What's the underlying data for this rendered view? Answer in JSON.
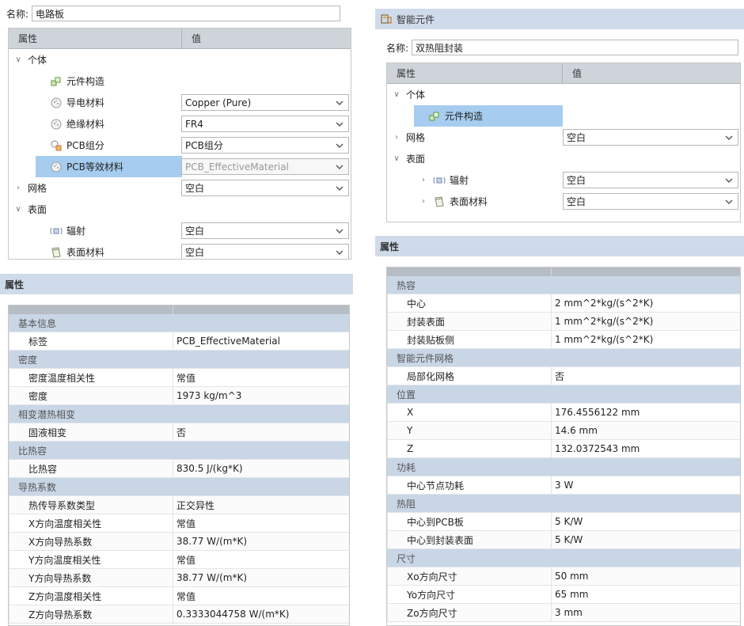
{
  "left": {
    "name_label": "名称:",
    "name_value": "电路板",
    "tree_header": {
      "col_attr": "属性",
      "col_value": "值"
    },
    "tree": [
      {
        "label": "个体",
        "depth": 0,
        "expand": "open",
        "icon": ""
      },
      {
        "label": "元件构造",
        "depth": 1,
        "icon": "component-build-icon"
      },
      {
        "label": "导电材料",
        "depth": 1,
        "icon": "material-icon",
        "value": "Copper (Pure)"
      },
      {
        "label": "绝缘材料",
        "depth": 1,
        "icon": "material-icon",
        "value": "FR4"
      },
      {
        "label": "PCB组分",
        "depth": 1,
        "icon": "pcb-component-icon",
        "value": "PCB组分"
      },
      {
        "label": "PCB等效材料",
        "depth": 1,
        "icon": "material-icon",
        "value": "PCB_EffectiveMaterial",
        "selected": true,
        "disabled": true
      },
      {
        "label": "网格",
        "depth": 0,
        "expand": "closed",
        "value": "空白"
      },
      {
        "label": "表面",
        "depth": 0,
        "expand": "open"
      },
      {
        "label": "辐射",
        "depth": 1,
        "icon": "radiation-icon",
        "value": "空白"
      },
      {
        "label": "表面材料",
        "depth": 1,
        "icon": "surface-material-icon",
        "value": "空白"
      }
    ],
    "props_title": "属性",
    "props": [
      {
        "type": "cat",
        "k": "基本信息"
      },
      {
        "type": "item",
        "k": "标签",
        "v": "PCB_EffectiveMaterial"
      },
      {
        "type": "cat",
        "k": "密度"
      },
      {
        "type": "item",
        "k": "密度温度相关性",
        "v": "常值"
      },
      {
        "type": "item",
        "k": "密度",
        "v": "1973 kg/m^3"
      },
      {
        "type": "cat",
        "k": "相变潜热相变"
      },
      {
        "type": "item",
        "k": "固液相变",
        "v": "否"
      },
      {
        "type": "cat",
        "k": "比热容"
      },
      {
        "type": "item",
        "k": "比热容",
        "v": "830.5 J/(kg*K)"
      },
      {
        "type": "cat",
        "k": "导热系数"
      },
      {
        "type": "item",
        "k": "热传导系数类型",
        "v": "正交异性"
      },
      {
        "type": "item",
        "k": "X方向温度相关性",
        "v": "常值"
      },
      {
        "type": "item",
        "k": "X方向导热系数",
        "v": "38.77 W/(m*K)"
      },
      {
        "type": "item",
        "k": "Y方向温度相关性",
        "v": "常值"
      },
      {
        "type": "item",
        "k": "Y方向导热系数",
        "v": "38.77 W/(m*K)"
      },
      {
        "type": "item",
        "k": "Z方向温度相关性",
        "v": "常值"
      },
      {
        "type": "item",
        "k": "Z方向导热系数",
        "v": "0.3333044758 W/(m*K)"
      }
    ]
  },
  "right": {
    "panel_title": "智能元件",
    "name_label": "名称:",
    "name_value": "双热阻封装",
    "tree_header": {
      "col_attr": "属性",
      "col_value": "值"
    },
    "tree": [
      {
        "label": "个体",
        "depth": 0,
        "expand": "open"
      },
      {
        "label": "元件构造",
        "depth": 1,
        "icon": "component-build-icon",
        "selected": true
      },
      {
        "label": "网格",
        "depth": 0,
        "expand": "closed",
        "value": "空白"
      },
      {
        "label": "表面",
        "depth": 0,
        "expand": "open"
      },
      {
        "label": "辐射",
        "depth": 1,
        "expand": "closed",
        "icon": "radiation-icon",
        "value": "空白"
      },
      {
        "label": "表面材料",
        "depth": 1,
        "expand": "closed",
        "icon": "surface-material-icon",
        "value": "空白"
      }
    ],
    "props_title": "属性",
    "props": [
      {
        "type": "cat",
        "k": "热容"
      },
      {
        "type": "item",
        "k": "中心",
        "v": "2 mm^2*kg/(s^2*K)"
      },
      {
        "type": "item",
        "k": "封装表面",
        "v": "1 mm^2*kg/(s^2*K)"
      },
      {
        "type": "item",
        "k": "封装贴板侧",
        "v": "1 mm^2*kg/(s^2*K)"
      },
      {
        "type": "cat",
        "k": "智能元件网格"
      },
      {
        "type": "item",
        "k": "局部化网格",
        "v": "否"
      },
      {
        "type": "cat",
        "k": "位置"
      },
      {
        "type": "item",
        "k": "X",
        "v": "176.4556122 mm"
      },
      {
        "type": "item",
        "k": "Y",
        "v": "14.6 mm"
      },
      {
        "type": "item",
        "k": "Z",
        "v": "132.0372543 mm"
      },
      {
        "type": "cat",
        "k": "功耗"
      },
      {
        "type": "item",
        "k": "中心节点功耗",
        "v": "3 W"
      },
      {
        "type": "cat",
        "k": "热阻"
      },
      {
        "type": "item",
        "k": "中心到PCB板",
        "v": "5 K/W"
      },
      {
        "type": "item",
        "k": "中心到封装表面",
        "v": "5 K/W"
      },
      {
        "type": "cat",
        "k": "尺寸"
      },
      {
        "type": "item",
        "k": "Xo方向尺寸",
        "v": "50 mm"
      },
      {
        "type": "item",
        "k": "Yo方向尺寸",
        "v": "65 mm"
      },
      {
        "type": "item",
        "k": "Zo方向尺寸",
        "v": "3 mm"
      }
    ]
  }
}
